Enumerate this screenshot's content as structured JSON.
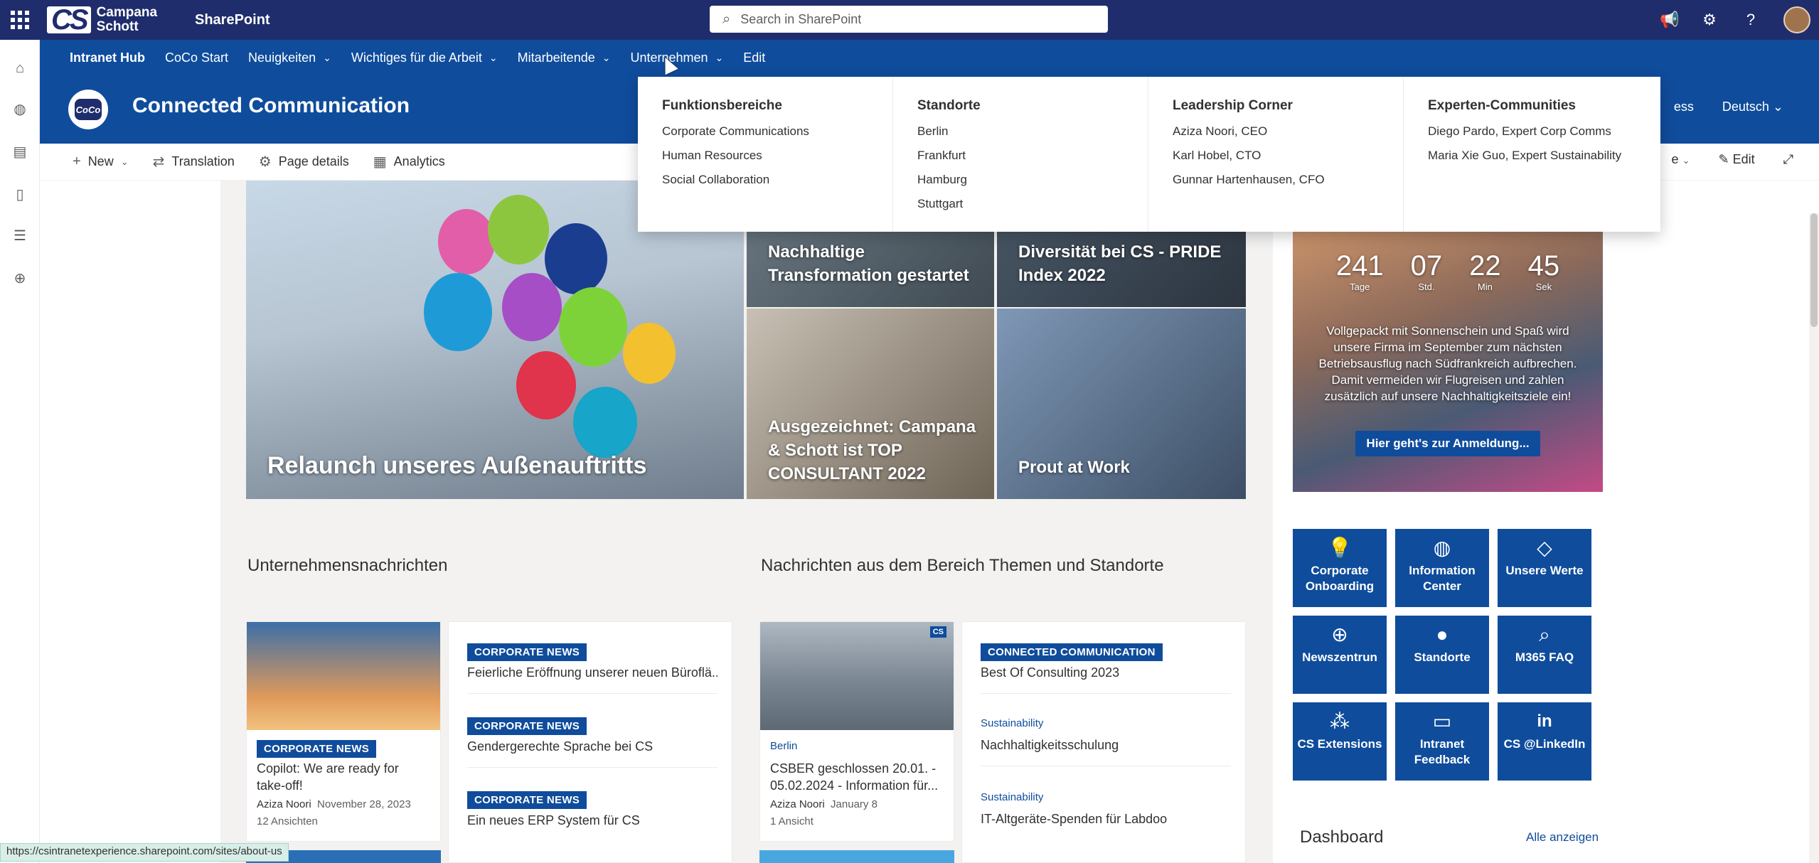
{
  "suite": {
    "brand_mark": "CS",
    "brand_line1": "Campana",
    "brand_line2": "Schott",
    "app_name": "SharePoint",
    "search_placeholder": "Search in SharePoint",
    "icons": [
      "megaphone-icon",
      "settings-gear-icon",
      "help-icon",
      "profile-avatar"
    ]
  },
  "rail": {
    "icons": [
      "home-icon",
      "globe-icon",
      "news-icon",
      "document-icon",
      "list-icon",
      "add-circle-icon"
    ]
  },
  "hubnav": {
    "items": [
      {
        "label": "Intranet Hub",
        "chevron": false
      },
      {
        "label": "CoCo Start",
        "chevron": false
      },
      {
        "label": "Neuigkeiten",
        "chevron": true
      },
      {
        "label": "Wichtiges für die Arbeit",
        "chevron": true
      },
      {
        "label": "Mitarbeitende",
        "chevron": true
      },
      {
        "label": "Unternehmen",
        "chevron": true
      },
      {
        "label": "Edit",
        "chevron": false
      }
    ]
  },
  "site": {
    "logo_text": "CoCo",
    "title": "Connected Communication",
    "right_partial": "ess",
    "language": "Deutsch"
  },
  "commandbar": {
    "new": "New",
    "translation": "Translation",
    "page_details": "Page details",
    "analytics": "Analytics",
    "right_partial": "e",
    "edit": "Edit"
  },
  "megamenu": {
    "columns": [
      {
        "heading": "Funktionsbereiche",
        "items": [
          "Corporate Communications",
          "Human Resources",
          "Social Collaboration"
        ]
      },
      {
        "heading": "Standorte",
        "items": [
          "Berlin",
          "Frankfurt",
          "Hamburg",
          "Stuttgart"
        ]
      },
      {
        "heading": "Leadership Corner",
        "items": [
          "Aziza Noori, CEO",
          "Karl Hobel, CTO",
          "Gunnar Hartenhausen, CFO"
        ]
      },
      {
        "heading": "Experten-Communities",
        "items": [
          "Diego Pardo, Expert Corp Comms",
          "Maria Xie Guo, Expert Sustainability"
        ]
      }
    ]
  },
  "hero": {
    "big": "Relaunch unseres Außenauftritts",
    "tile_a": "Nachhaltige Transformation gestartet",
    "tile_b": "Diversität bei CS - PRIDE Index 2022",
    "tile_c": "Ausgezeichnet: Campana & Schott ist TOP CONSULTANT 2022",
    "tile_d": "Prout at Work"
  },
  "news_left": {
    "title": "Unternehmensnachrichten",
    "featured": {
      "tag": "CORPORATE NEWS",
      "headline": "Copilot: We are ready for take-off!",
      "author": "Aziza Noori",
      "date": "November 28, 2023",
      "views": "12 Ansichten"
    },
    "list": [
      {
        "tag": "CORPORATE NEWS",
        "headline": "Feierliche Eröffnung unserer neuen Büroflä..."
      },
      {
        "tag": "CORPORATE NEWS",
        "headline": "Gendergerechte Sprache bei CS"
      },
      {
        "tag": "CORPORATE NEWS",
        "headline": "Ein neues ERP System für CS"
      }
    ]
  },
  "news_right": {
    "title": "Nachrichten aus dem Bereich Themen und Standorte",
    "featured": {
      "topic": "Berlin",
      "headline": "CSBER geschlossen 20.01. - 05.02.2024 - Information für...",
      "author": "Aziza Noori",
      "date": "January 8",
      "views": "1 Ansicht",
      "badge": "CS"
    },
    "list": [
      {
        "tag": "CONNECTED COMMUNICATION",
        "headline": "Best Of Consulting 2023"
      },
      {
        "topic": "Sustainability",
        "headline": "Nachhaltigkeitsschulung"
      },
      {
        "topic": "Sustainability",
        "headline": "IT-Altgeräte-Spenden für Labdoo"
      }
    ]
  },
  "countdown": {
    "units": [
      {
        "value": "241",
        "label": "Tage"
      },
      {
        "value": "07",
        "label": "Std."
      },
      {
        "value": "22",
        "label": "Min"
      },
      {
        "value": "45",
        "label": "Sek"
      }
    ],
    "text": "Vollgepackt mit Sonnenschein und Spaß wird unsere Firma im September zum nächsten Betriebsausflug nach Südfrankreich aufbrechen. Damit vermeiden wir Flugreisen und zahlen zusätzlich auf unsere Nachhaltigkeitsziele ein!",
    "button": "Hier geht's zur Anmeldung..."
  },
  "quicklinks": [
    {
      "label": "Corporate Onboarding",
      "icon": "lightbulb-icon"
    },
    {
      "label": "Information Center",
      "icon": "globe-stand-icon"
    },
    {
      "label": "Unsere Werte",
      "icon": "diamond-icon"
    },
    {
      "label": "Newszentrun",
      "icon": "globe-icon"
    },
    {
      "label": "Standorte",
      "icon": "location-pin-icon"
    },
    {
      "label": "M365 FAQ",
      "icon": "search-icon"
    },
    {
      "label": "CS Extensions",
      "icon": "apps-icon"
    },
    {
      "label": "Intranet Feedback",
      "icon": "feedback-icon"
    },
    {
      "label": "CS @LinkedIn",
      "icon": "linkedin-icon"
    }
  ],
  "dashboard": {
    "title": "Dashboard",
    "link": "Alle anzeigen"
  },
  "statusbar": "https://csintranetexperience.sharepoint.com/sites/about-us"
}
